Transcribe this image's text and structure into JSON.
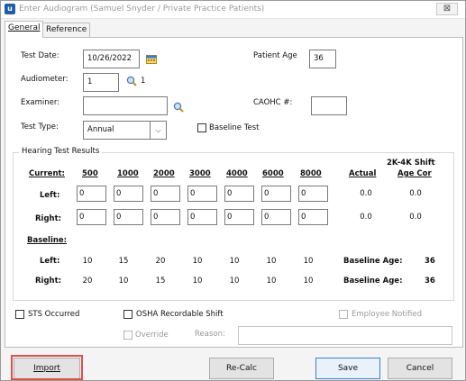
{
  "window": {
    "title": "Enter Audiogram (Samuel Snyder / Private Practice Patients)",
    "close_label": "⊠"
  },
  "tabs": [
    {
      "label": "General",
      "active": true
    },
    {
      "label": "Reference",
      "active": false
    }
  ],
  "form": {
    "test_date_label": "Test Date:",
    "test_date_value": "10/26/2022",
    "patient_age_label": "Patient Age",
    "patient_age_value": "36",
    "audiometer_label": "Audiometer:",
    "audiometer_value": "1",
    "audiometer_lookup_result": "1",
    "examiner_label": "Examiner:",
    "examiner_value": "",
    "caohc_label": "CAOHC #:",
    "caohc_value": "",
    "test_type_label": "Test Type:",
    "test_type_value": "Annual",
    "baseline_test_label": "Baseline Test"
  },
  "results": {
    "group_title": "Hearing Test Results",
    "shift_header": "2K-4K Shift",
    "actual_header": "Actual",
    "age_cor_header": "Age Cor",
    "current_label": "Current:",
    "baseline_label": "Baseline:",
    "left_label": "Left:",
    "right_label": "Right:",
    "frequencies": [
      "500",
      "1000",
      "2000",
      "3000",
      "4000",
      "6000",
      "8000"
    ],
    "current_left": [
      "0",
      "0",
      "0",
      "0",
      "0",
      "0",
      "0"
    ],
    "current_right": [
      "0",
      "0",
      "0",
      "0",
      "0",
      "0",
      "0"
    ],
    "shift_left": {
      "actual": "0.0",
      "age_cor": "0.0"
    },
    "shift_right": {
      "actual": "0.0",
      "age_cor": "0.0"
    },
    "baseline_left": [
      "10",
      "15",
      "20",
      "10",
      "10",
      "10",
      "10"
    ],
    "baseline_right": [
      "20",
      "10",
      "15",
      "10",
      "10",
      "10",
      "10"
    ],
    "baseline_age_label": "Baseline Age:",
    "baseline_age_left": "36",
    "baseline_age_right": "36"
  },
  "bottom": {
    "sts_label": "STS Occurred",
    "osha_label": "OSHA Recordable Shift",
    "employee_notified_label": "Employee Notified",
    "override_label": "Override",
    "reason_label": "Reason:",
    "reason_value": ""
  },
  "buttons": {
    "import": "Import",
    "recalc": "Re-Calc",
    "save": "Save",
    "cancel": "Cancel"
  },
  "colors": {
    "highlight": "#e0504a",
    "accent": "#3c7fd3"
  }
}
